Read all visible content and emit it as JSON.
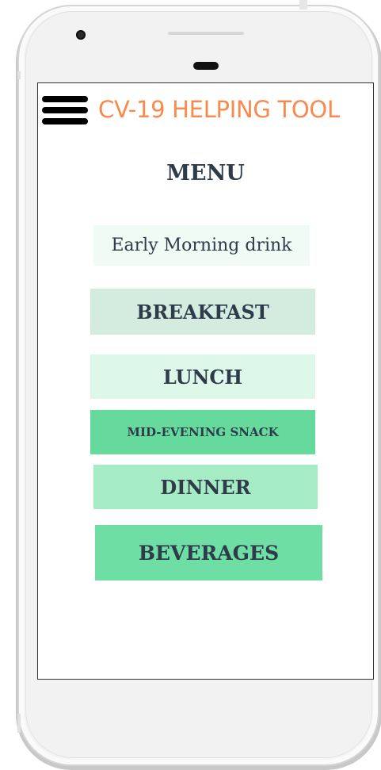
{
  "app": {
    "title": "CV-19 HELPING TOOL"
  },
  "menu": {
    "heading": "MENU",
    "items": [
      {
        "label": "Early Morning drink",
        "color": "#effbf4"
      },
      {
        "label": "BREAKFAST",
        "color": "#d4ece0"
      },
      {
        "label": "LUNCH",
        "color": "#ddf7e8"
      },
      {
        "label": "MID-EVENING SNACK",
        "color": "#66da9d"
      },
      {
        "label": "DINNER",
        "color": "#a5ebc3"
      },
      {
        "label": "BEVERAGES",
        "color": "#6fdea5"
      }
    ]
  },
  "colors": {
    "title": "#f98a4f",
    "text": "#2f3b4a"
  },
  "icons": {
    "menu": "hamburger-icon"
  }
}
